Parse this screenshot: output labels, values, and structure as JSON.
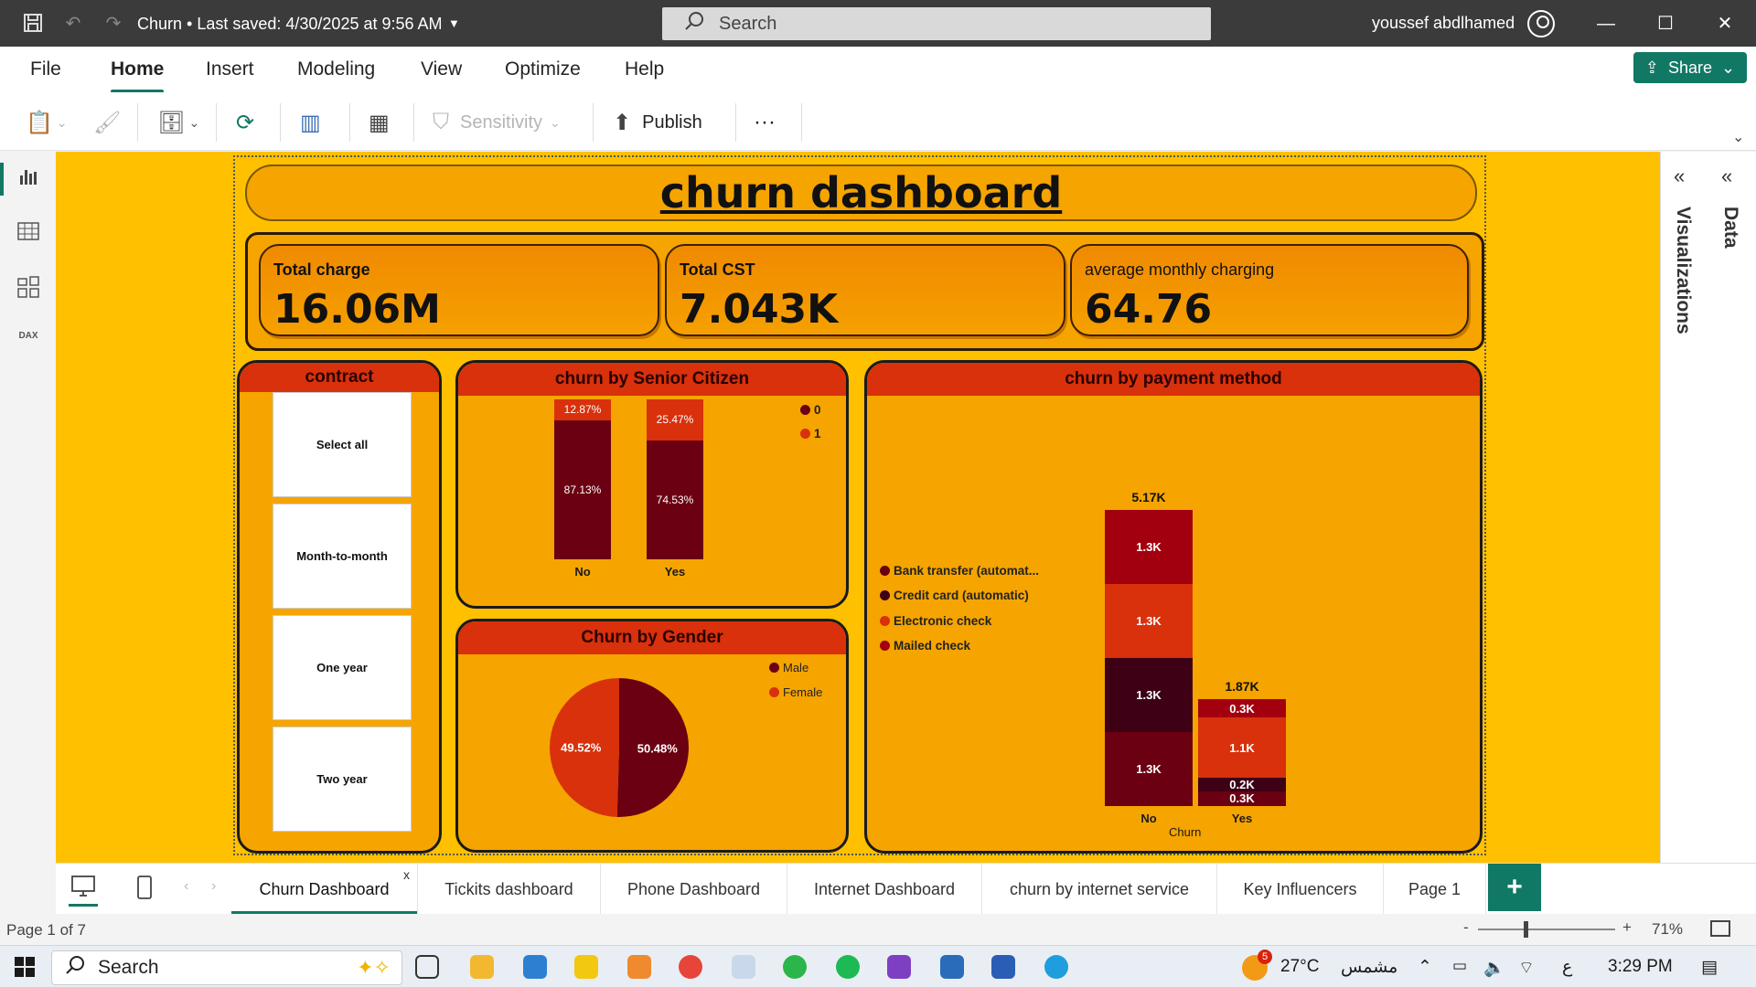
{
  "titlebar": {
    "doc_title": "Churn • Last saved: 4/30/2025 at 9:56 AM",
    "search_placeholder": "Search",
    "user": "youssef abdlhamed"
  },
  "menu": {
    "items": [
      "File",
      "Home",
      "Insert",
      "Modeling",
      "View",
      "Optimize",
      "Help"
    ],
    "share_label": "Share"
  },
  "toolbar": {
    "sensitivity_label": "Sensitivity",
    "publish_label": "Publish",
    "more_label": "···"
  },
  "report": {
    "title": "churn dashboard",
    "kpis": [
      {
        "label": "Total charge",
        "value": "16.06M"
      },
      {
        "label": "Total CST",
        "value": "7.043K"
      },
      {
        "label": "average monthly charging",
        "value": "64.76"
      }
    ],
    "contract": {
      "title": "contract",
      "options": [
        "Select all",
        "Month-to-month",
        "One year",
        "Two year"
      ]
    },
    "senior": {
      "title": "churn by Senior Citizen",
      "legend": [
        "0",
        "1"
      ],
      "colors": [
        "#6b0012",
        "#d8310b"
      ],
      "bars": [
        {
          "category": "No",
          "segments": [
            {
              "label": "87.13%",
              "value": 87.13
            },
            {
              "label": "12.87%",
              "value": 12.87
            }
          ]
        },
        {
          "category": "Yes",
          "segments": [
            {
              "label": "74.53%",
              "value": 74.53
            },
            {
              "label": "25.47%",
              "value": 25.47
            }
          ]
        }
      ]
    },
    "gender": {
      "title": "Churn by Gender",
      "legend": [
        "Male",
        "Female"
      ],
      "colors": [
        "#6b0012",
        "#d8310b"
      ],
      "slices": [
        {
          "name": "Male",
          "label": "50.48%",
          "value": 50.48
        },
        {
          "name": "Female",
          "label": "49.52%",
          "value": 49.52
        }
      ]
    },
    "payment": {
      "title": "churn by payment method",
      "legend": [
        "Bank transfer (automat...",
        "Credit card (automatic)",
        "Electronic check",
        "Mailed check"
      ],
      "colors": [
        "#6b0012",
        "#3d0015",
        "#d8310b",
        "#a3000f"
      ],
      "x_axis_title": "Churn",
      "bars": [
        {
          "category": "No",
          "total": "5.17K",
          "segments": [
            {
              "label": "1.3K",
              "value": 1.3,
              "color": "#6b0012"
            },
            {
              "label": "1.3K",
              "value": 1.3,
              "color": "#3d0015"
            },
            {
              "label": "1.3K",
              "value": 1.3,
              "color": "#d8310b"
            },
            {
              "label": "1.3K",
              "value": 1.3,
              "color": "#a3000f"
            }
          ]
        },
        {
          "category": "Yes",
          "total": "1.87K",
          "segments": [
            {
              "label": "0.3K",
              "value": 0.26,
              "color": "#6b0012"
            },
            {
              "label": "0.2K",
              "value": 0.23,
              "color": "#3d0015"
            },
            {
              "label": "1.1K",
              "value": 1.07,
              "color": "#d8310b"
            },
            {
              "label": "0.3K",
              "value": 0.31,
              "color": "#a3000f"
            }
          ]
        }
      ]
    }
  },
  "right_pane": {
    "visualizations": "Visualizations",
    "data": "Data"
  },
  "tabs": {
    "pages": [
      "Churn Dashboard",
      "Tickits dashboard",
      "Phone Dashboard",
      "Internet Dashboard",
      "churn by internet service",
      "Key Influencers",
      "Page 1"
    ],
    "close": "x",
    "add": "+"
  },
  "status": {
    "page": "Page 1 of 7",
    "zoom": "71%",
    "minus": "-",
    "plus": "+"
  },
  "taskbar": {
    "search": "Search",
    "notification_count": "5",
    "temperature": "27°C",
    "weather": "مشمس",
    "lang": "ع",
    "time": "3:29 PM"
  }
}
